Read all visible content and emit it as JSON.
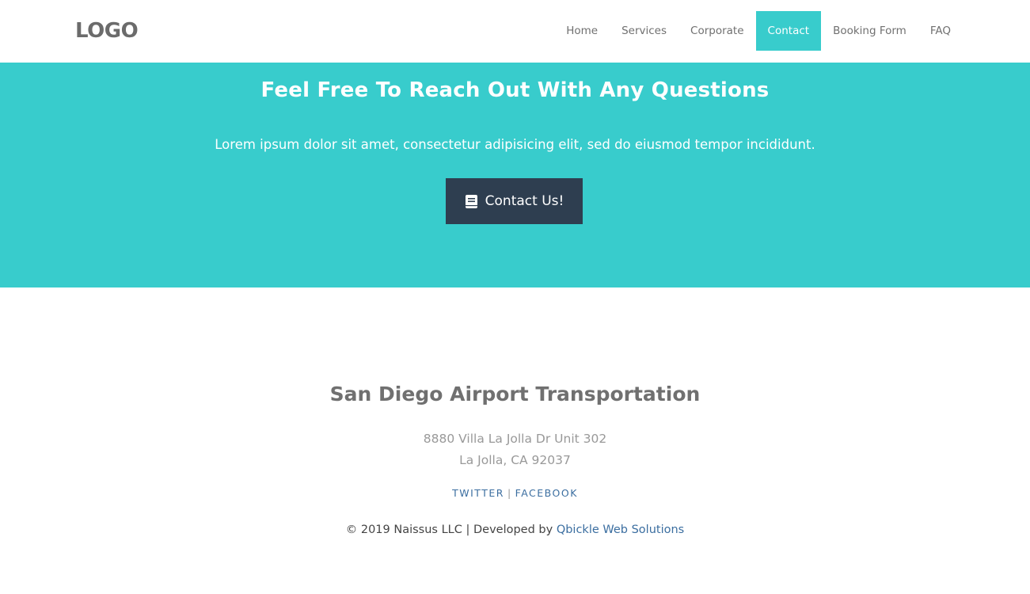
{
  "header": {
    "logo": "LOGO",
    "nav": [
      {
        "label": "Home"
      },
      {
        "label": "Services"
      },
      {
        "label": "Corporate"
      },
      {
        "label": "Contact",
        "active": true
      },
      {
        "label": "Booking Form"
      },
      {
        "label": "FAQ"
      }
    ]
  },
  "hero": {
    "title": "Feel Free To Reach Out With Any Questions",
    "text": "Lorem ipsum dolor sit amet, consectetur adipisicing elit, sed do eiusmod tempor incididunt.",
    "button_label": "Contact Us!",
    "button_icon": "book-icon",
    "background_color": "#38cccc",
    "button_color": "#2e3e50"
  },
  "footer": {
    "company": "San Diego Airport Transportation",
    "address_line1": "8880 Villa La Jolla Dr Unit 302",
    "address_line2": "La Jolla, CA 92037",
    "social": {
      "twitter": "TWITTER",
      "separator": "|",
      "facebook": "FACEBOOK"
    },
    "copyright_text": "© 2019 Naissus LLC | Developed by ",
    "developer_link": "Qbickle Web Solutions",
    "link_color": "#3b6ea0"
  }
}
